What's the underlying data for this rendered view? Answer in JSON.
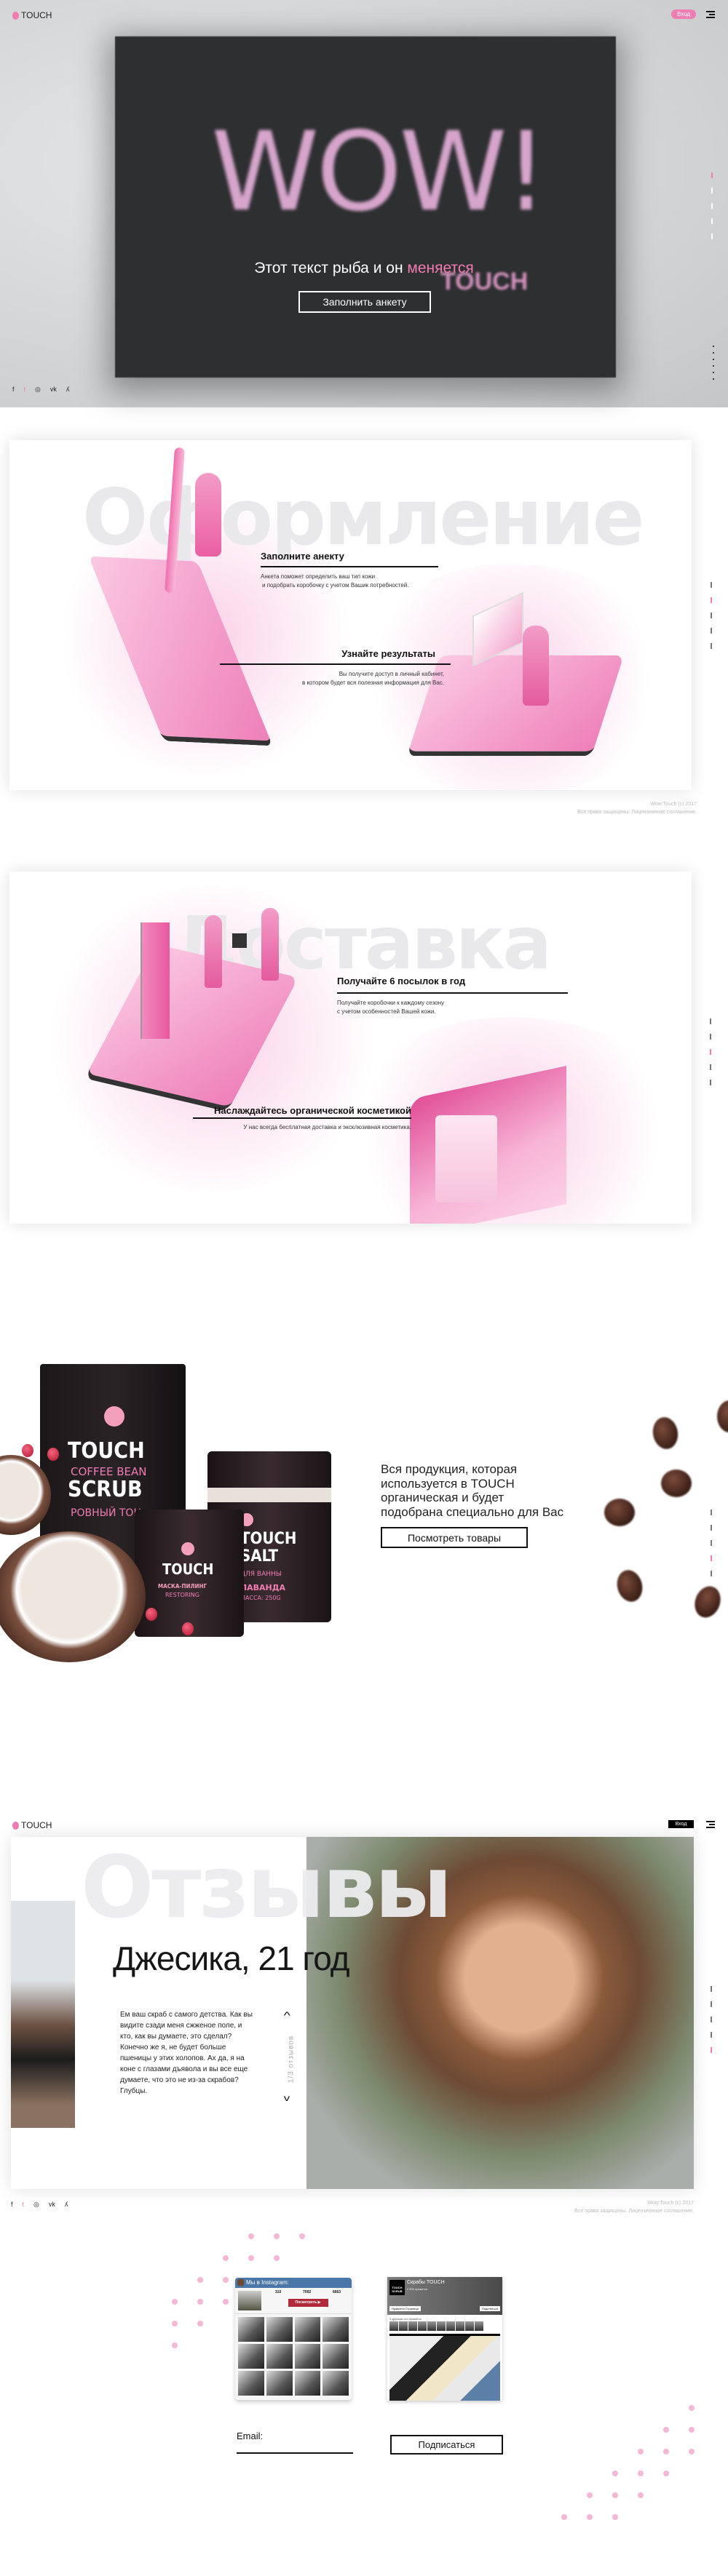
{
  "brand": {
    "name": "TOUCH",
    "accent": "#f07cb4"
  },
  "header": {
    "login_label": "Вход",
    "menu_icon": "hamburger-icon"
  },
  "hero": {
    "image_word": "WOW!",
    "image_mark": "TOUCH",
    "headline_main": "Этот текст рыба и он ",
    "headline_accent": "меняется",
    "cta_label": "Заполнить анкету"
  },
  "social": [
    "f",
    "t",
    "◎",
    "vk",
    "ʎ"
  ],
  "design_section": {
    "title": "Оформление",
    "steps": [
      {
        "heading": "Заполните анекту",
        "text": [
          "Анкета поможет определить ваш тип кожи",
          "и подобрать коробочку с учетом Вашик потребностей."
        ]
      },
      {
        "heading": "Узнайте результаты",
        "text": [
          "Вы получите доступ в личный кабинет,",
          "в котором будет вся полезная информация для Вас."
        ]
      }
    ]
  },
  "delivery_section": {
    "title": "Доставка",
    "steps": [
      {
        "heading": "Получайте 6 посылок в год",
        "text": [
          "Получайте коробочки к каждому сезону",
          "с учетом особенностей Вашей кожи."
        ]
      },
      {
        "heading": "Наслаждайтесь органической косметикой",
        "text": [
          "У нас всегда бесплатная доставка и эксклюзивная косметика."
        ]
      }
    ]
  },
  "footer": {
    "line1": "Wow Touch (c) 2017",
    "line2": "Все права защищены. Лицензионное соглашение."
  },
  "products_section": {
    "text": [
      "Вся продукция, которая",
      "используется в TOUCH",
      "органическая и будет",
      "подобрана специально для Вас"
    ],
    "cta_label": "Посмотреть товары",
    "packaging": {
      "pouch": [
        "TOUCH",
        "COFFEE BEAN",
        "SCRUB",
        "РОВНЫЙ ТОН"
      ],
      "jar_small": [
        "TOUCH",
        "МАСКА-ПИЛИНГ",
        "RESTORING"
      ],
      "jar_big": [
        "TOUCH",
        "SALT",
        "ДЛЯ ВАННЫ",
        "ЛАВАНДА",
        "МАССА: 250G"
      ]
    }
  },
  "reviews_section": {
    "title": "Отзывы",
    "name": "Джесика, 21 год",
    "quote": "Ем ваш скраб с самого детства. Как вы видите сзади меня сжженое поле, и кто, как вы думаете, это сделал? Конечно же я, не будет больше пшеницы у этих холопов. Ах да, я на коне с глазами дъявола и вы все еще думаете, что это не из-за скрабов? Глубцы.",
    "counter": "1/3 отзывов",
    "login_label": "Вход"
  },
  "instagram_widget": {
    "title": "Мы в Instagram:",
    "stats": [
      "310",
      "7092",
      "6663"
    ],
    "button_label": "Посмотреть ▶"
  },
  "facebook_widget": {
    "page_name": "Скрабы TOUCH",
    "likes": "2 800 нравится",
    "like_button": "Нравится Страница",
    "share_button": "Поделиться",
    "friends_text": "3 друзьям это нравится",
    "logo_text": "TOUCH SCRUB"
  },
  "subscribe": {
    "email_label": "Email:",
    "email_value": "",
    "button_label": "Подписаться"
  }
}
